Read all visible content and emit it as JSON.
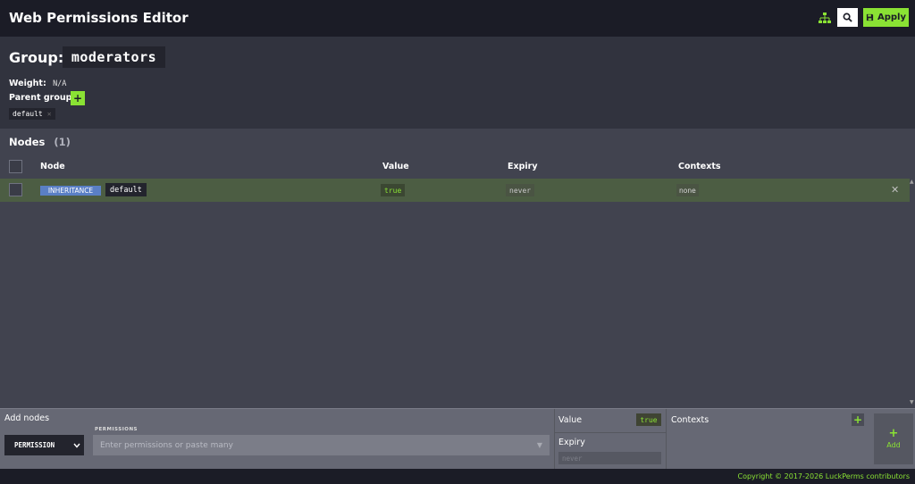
{
  "header": {
    "title": "Web Permissions Editor",
    "apply_label": "Apply"
  },
  "group": {
    "label": "Group:",
    "name": "moderators",
    "weight_label": "Weight:",
    "weight_value": "N/A",
    "parent_groups_label": "Parent groups",
    "parent_add_label": "+",
    "parents": [
      "default"
    ]
  },
  "nodes": {
    "title": "Nodes",
    "count": "(1)",
    "columns": {
      "node": "Node",
      "value": "Value",
      "expiry": "Expiry",
      "contexts": "Contexts"
    },
    "rows": [
      {
        "type_badge": "INHERITANCE",
        "node": "default",
        "value": "true",
        "expiry": "never",
        "contexts": "none"
      }
    ]
  },
  "add_panel": {
    "title": "Add nodes",
    "type_selected": "PERMISSION",
    "permissions_label": "PERMISSIONS",
    "permissions_placeholder": "Enter permissions or paste many",
    "value_label": "Value",
    "value": "true",
    "expiry_label": "Expiry",
    "expiry_placeholder": "never",
    "contexts_label": "Contexts",
    "contexts_add_label": "+",
    "add_plus": "+",
    "add_label": "Add"
  },
  "footer": {
    "copyright": "Copyright © 2017-2026 LuckPerms contributors"
  },
  "colors": {
    "accent": "#8ae234",
    "topbar": "#1b1c26",
    "row_highlight": "#4c5d43",
    "inheritance_badge": "#5a7fc5"
  }
}
